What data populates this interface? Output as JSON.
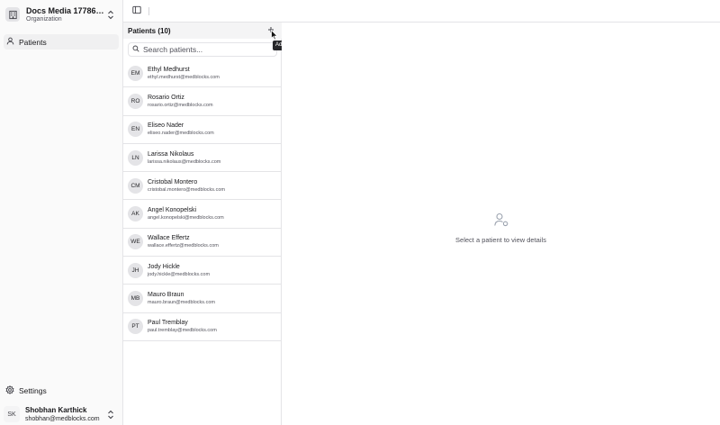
{
  "sidebar": {
    "org_name": "Docs Media 1778650...",
    "org_subtitle": "Organization",
    "nav": [
      {
        "label": "Patients",
        "icon": "user-icon",
        "active": true
      }
    ],
    "settings_label": "Settings",
    "user": {
      "initials": "SK",
      "name": "Shobhan Karthick",
      "email": "shobhan@medblocks.com"
    }
  },
  "patients_panel": {
    "title": "Patients (10)",
    "search_placeholder": "Search patients...",
    "add_tooltip": "Add patient",
    "patients": [
      {
        "initials": "EM",
        "name": "Ethyl Medhurst",
        "email": "ethyl.medhurst@medblocks.com"
      },
      {
        "initials": "RO",
        "name": "Rosario Ortiz",
        "email": "rosario.ortiz@medblocks.com"
      },
      {
        "initials": "EN",
        "name": "Eliseo Nader",
        "email": "eliseo.nader@medblocks.com"
      },
      {
        "initials": "LN",
        "name": "Larissa Nikolaus",
        "email": "larissa.nikolaus@medblocks.com"
      },
      {
        "initials": "CM",
        "name": "Cristobal Montero",
        "email": "cristobal.montero@medblocks.com"
      },
      {
        "initials": "AK",
        "name": "Angel Konopelski",
        "email": "angel.konopelski@medblocks.com"
      },
      {
        "initials": "WE",
        "name": "Wallace Effertz",
        "email": "wallace.effertz@medblocks.com"
      },
      {
        "initials": "JH",
        "name": "Jody Hickle",
        "email": "jody.hickle@medblocks.com"
      },
      {
        "initials": "MB",
        "name": "Mauro Braun",
        "email": "mauro.braun@medblocks.com"
      },
      {
        "initials": "PT",
        "name": "Paul Tremblay",
        "email": "paul.tremblay@medblocks.com"
      }
    ]
  },
  "details": {
    "empty_message": "Select a patient to view details"
  },
  "colors": {
    "sidebar_bg": "#fafafa",
    "border": "#e4e4e7",
    "tooltip_bg": "#27272a",
    "avatar_bg": "#e4e4e7"
  }
}
